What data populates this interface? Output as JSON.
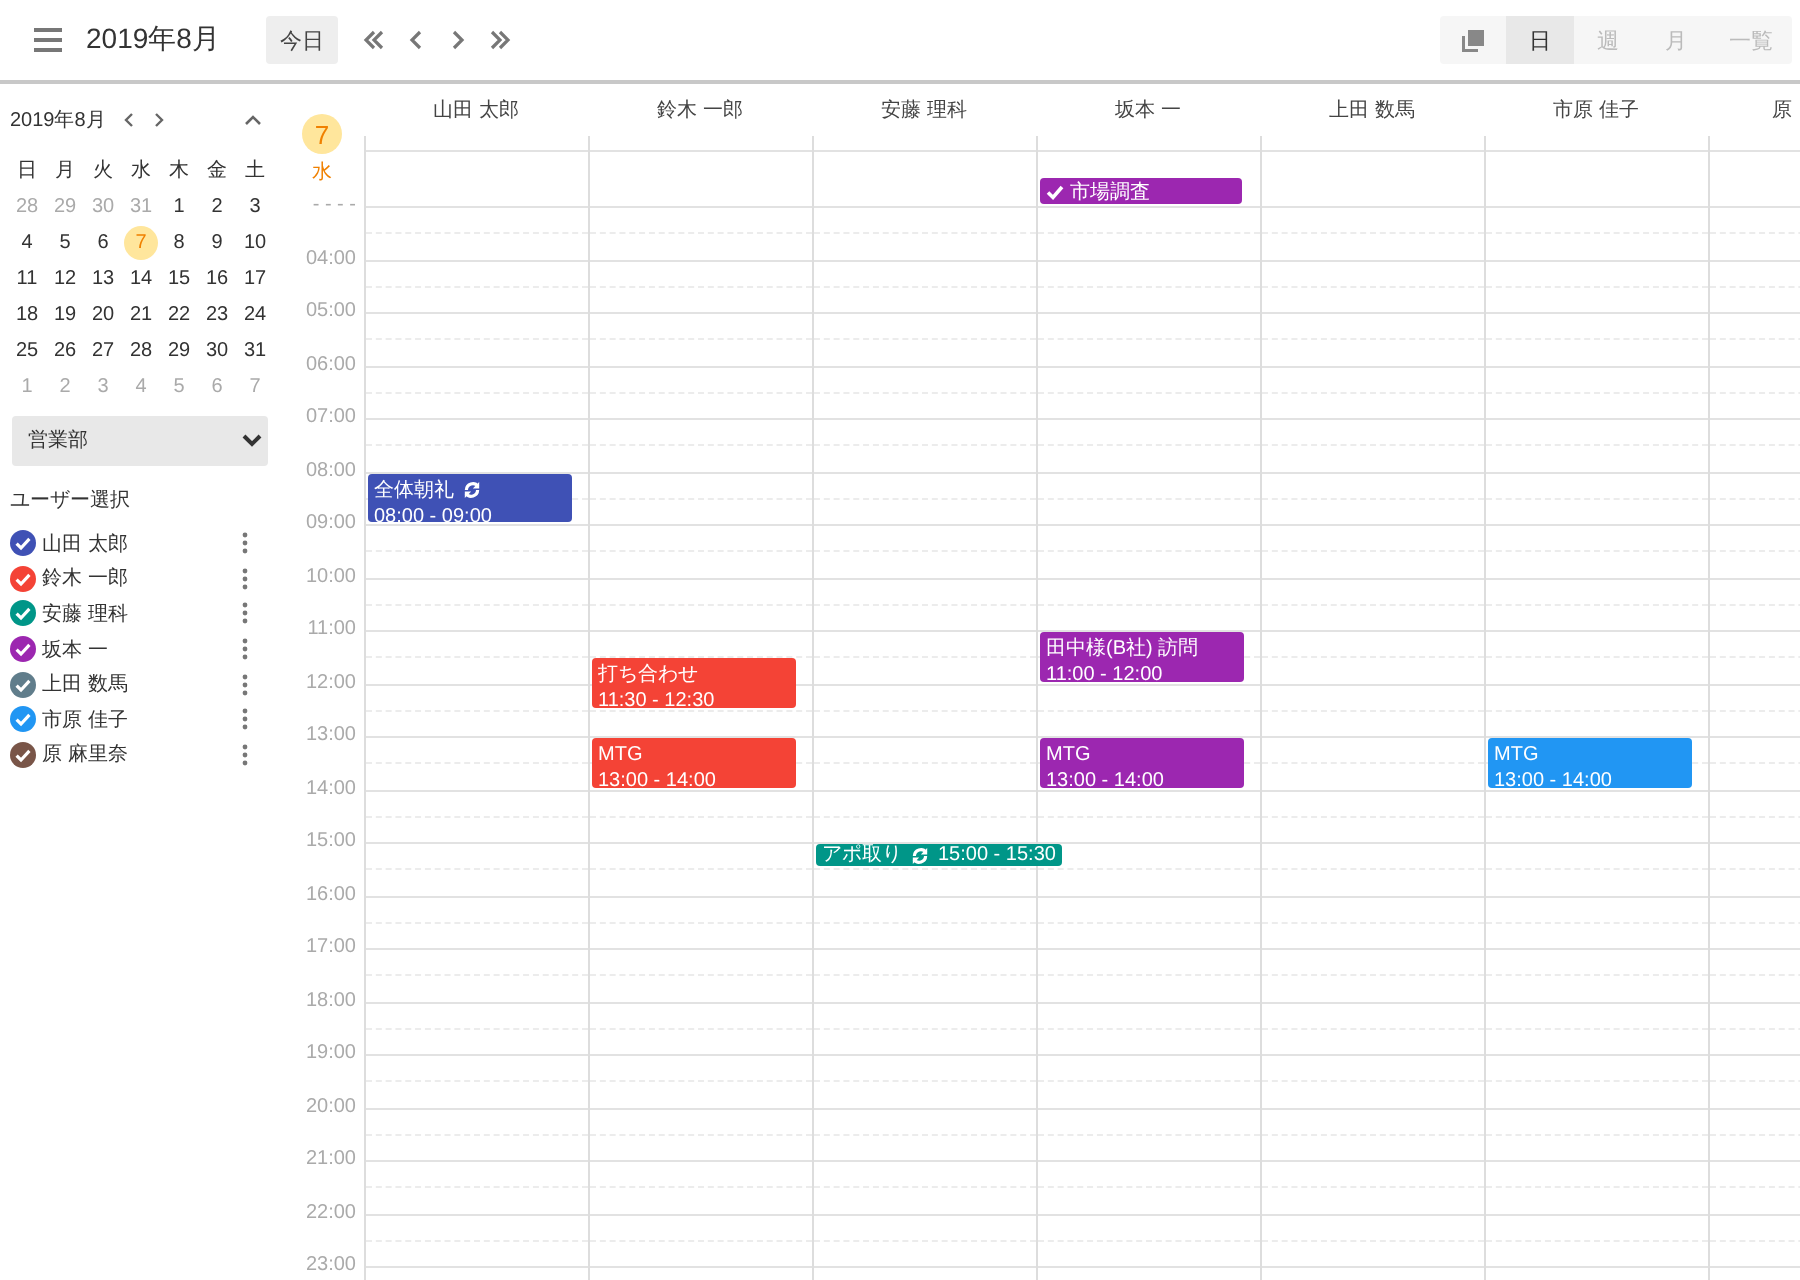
{
  "header": {
    "title": "2019年8月",
    "today_button": "今日",
    "views": [
      {
        "label": "日",
        "selected": true
      },
      {
        "label": "週",
        "selected": false
      },
      {
        "label": "月",
        "selected": false
      },
      {
        "label": "一覧",
        "selected": false
      }
    ]
  },
  "mini_calendar": {
    "title": "2019年8月",
    "weekdays": [
      "日",
      "月",
      "火",
      "水",
      "木",
      "金",
      "土"
    ],
    "days": [
      {
        "label": "28",
        "outside": true,
        "selected": false
      },
      {
        "label": "29",
        "outside": true,
        "selected": false
      },
      {
        "label": "30",
        "outside": true,
        "selected": false
      },
      {
        "label": "31",
        "outside": true,
        "selected": false
      },
      {
        "label": "1",
        "outside": false,
        "selected": false
      },
      {
        "label": "2",
        "outside": false,
        "selected": false
      },
      {
        "label": "3",
        "outside": false,
        "selected": false
      },
      {
        "label": "4",
        "outside": false,
        "selected": false
      },
      {
        "label": "5",
        "outside": false,
        "selected": false
      },
      {
        "label": "6",
        "outside": false,
        "selected": false
      },
      {
        "label": "7",
        "outside": false,
        "selected": true
      },
      {
        "label": "8",
        "outside": false,
        "selected": false
      },
      {
        "label": "9",
        "outside": false,
        "selected": false
      },
      {
        "label": "10",
        "outside": false,
        "selected": false
      },
      {
        "label": "11",
        "outside": false,
        "selected": false
      },
      {
        "label": "12",
        "outside": false,
        "selected": false
      },
      {
        "label": "13",
        "outside": false,
        "selected": false
      },
      {
        "label": "14",
        "outside": false,
        "selected": false
      },
      {
        "label": "15",
        "outside": false,
        "selected": false
      },
      {
        "label": "16",
        "outside": false,
        "selected": false
      },
      {
        "label": "17",
        "outside": false,
        "selected": false
      },
      {
        "label": "18",
        "outside": false,
        "selected": false
      },
      {
        "label": "19",
        "outside": false,
        "selected": false
      },
      {
        "label": "20",
        "outside": false,
        "selected": false
      },
      {
        "label": "21",
        "outside": false,
        "selected": false
      },
      {
        "label": "22",
        "outside": false,
        "selected": false
      },
      {
        "label": "23",
        "outside": false,
        "selected": false
      },
      {
        "label": "24",
        "outside": false,
        "selected": false
      },
      {
        "label": "25",
        "outside": false,
        "selected": false
      },
      {
        "label": "26",
        "outside": false,
        "selected": false
      },
      {
        "label": "27",
        "outside": false,
        "selected": false
      },
      {
        "label": "28",
        "outside": false,
        "selected": false
      },
      {
        "label": "29",
        "outside": false,
        "selected": false
      },
      {
        "label": "30",
        "outside": false,
        "selected": false
      },
      {
        "label": "31",
        "outside": false,
        "selected": false
      },
      {
        "label": "1",
        "outside": true,
        "selected": false
      },
      {
        "label": "2",
        "outside": true,
        "selected": false
      },
      {
        "label": "3",
        "outside": true,
        "selected": false
      },
      {
        "label": "4",
        "outside": true,
        "selected": false
      },
      {
        "label": "5",
        "outside": true,
        "selected": false
      },
      {
        "label": "6",
        "outside": true,
        "selected": false
      },
      {
        "label": "7",
        "outside": true,
        "selected": false
      }
    ]
  },
  "department": "営業部",
  "user_section_title": "ユーザー選択",
  "users": [
    {
      "name": "山田 太郎",
      "color": "#3f51b5",
      "checked": true
    },
    {
      "name": "鈴木 一郎",
      "color": "#f44336",
      "checked": true
    },
    {
      "name": "安藤 理科",
      "color": "#009688",
      "checked": true
    },
    {
      "name": "坂本 一",
      "color": "#9c27b0",
      "checked": true
    },
    {
      "name": "上田 数馬",
      "color": "#607d8b",
      "checked": true
    },
    {
      "name": "市原 佳子",
      "color": "#2196f3",
      "checked": true
    },
    {
      "name": "原 麻里奈",
      "color": "#795548",
      "checked": true
    }
  ],
  "day": {
    "date": "7",
    "weekday": "水",
    "today": true
  },
  "time_labels": [
    "- - - -",
    "04:00",
    "05:00",
    "06:00",
    "07:00",
    "08:00",
    "09:00",
    "10:00",
    "11:00",
    "12:00",
    "13:00",
    "14:00",
    "15:00",
    "16:00",
    "17:00",
    "18:00",
    "19:00",
    "20:00",
    "21:00",
    "22:00",
    "23:00"
  ],
  "columns": [
    {
      "name": "山田 太郎",
      "events": [
        {
          "kind": "timed",
          "title": "全体朝礼",
          "time": "08:00 - 09:00",
          "recurring": true
        }
      ]
    },
    {
      "name": "鈴木 一郎",
      "events": [
        {
          "kind": "timed",
          "title": "打ち合わせ",
          "time": "11:30 - 12:30",
          "recurring": false
        },
        {
          "kind": "timed",
          "title": "MTG",
          "time": "13:00 - 14:00",
          "recurring": false
        }
      ]
    },
    {
      "name": "安藤 理科",
      "events": [
        {
          "kind": "timed",
          "title": "アポ取り",
          "time": "15:00 - 15:30",
          "recurring": true
        }
      ]
    },
    {
      "name": "坂本 一",
      "events": [
        {
          "kind": "allday",
          "title": "市場調査",
          "done": true
        },
        {
          "kind": "timed",
          "title": "田中様(B社) 訪問",
          "time": "11:00 - 12:00",
          "recurring": false
        },
        {
          "kind": "timed",
          "title": "MTG",
          "time": "13:00 - 14:00",
          "recurring": false
        }
      ]
    },
    {
      "name": "上田 数馬"
    },
    {
      "name": "市原 佳子",
      "events": [
        {
          "kind": "timed",
          "title": "MTG",
          "time": "13:00 - 14:00",
          "recurring": false
        }
      ]
    },
    {
      "name": "原"
    }
  ]
}
